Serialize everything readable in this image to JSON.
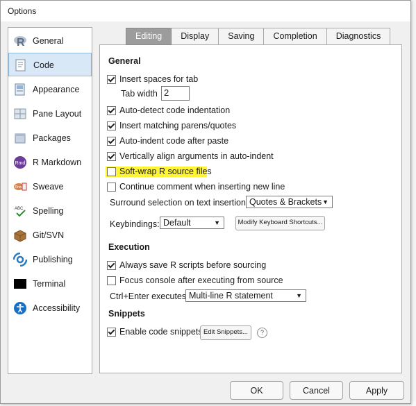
{
  "window": {
    "title": "Options"
  },
  "sidebar": {
    "items": [
      {
        "label": "General",
        "icon": "r-logo-icon"
      },
      {
        "label": "Code",
        "icon": "code-doc-icon",
        "active": true
      },
      {
        "label": "Appearance",
        "icon": "appearance-icon"
      },
      {
        "label": "Pane Layout",
        "icon": "pane-layout-icon"
      },
      {
        "label": "Packages",
        "icon": "packages-icon"
      },
      {
        "label": "R Markdown",
        "icon": "rmarkdown-icon"
      },
      {
        "label": "Sweave",
        "icon": "sweave-icon"
      },
      {
        "label": "Spelling",
        "icon": "spelling-icon"
      },
      {
        "label": "Git/SVN",
        "icon": "git-svn-icon"
      },
      {
        "label": "Publishing",
        "icon": "publishing-icon"
      },
      {
        "label": "Terminal",
        "icon": "terminal-icon"
      },
      {
        "label": "Accessibility",
        "icon": "accessibility-icon"
      }
    ]
  },
  "tabs": [
    "Editing",
    "Display",
    "Saving",
    "Completion",
    "Diagnostics"
  ],
  "editing": {
    "general_heading": "General",
    "insert_spaces": "Insert spaces for tab",
    "tab_width_label": "Tab width",
    "tab_width_value": "2",
    "auto_detect": "Auto-detect code indentation",
    "insert_matching": "Insert matching parens/quotes",
    "auto_indent": "Auto-indent code after paste",
    "vertically_align": "Vertically align arguments in auto-indent",
    "soft_wrap": "Soft-wrap R source files",
    "continue_comment": "Continue comment when inserting new line",
    "surround_label": "Surround selection on text insertion:",
    "surround_value": "Quotes & Brackets",
    "keybindings_label": "Keybindings:",
    "keybindings_value": "Default",
    "modify_shortcuts": "Modify Keyboard Shortcuts...",
    "execution_heading": "Execution",
    "always_save": "Always save R scripts before sourcing",
    "focus_console": "Focus console after executing from source",
    "ctrl_enter_label": "Ctrl+Enter executes:",
    "ctrl_enter_value": "Multi-line R statement",
    "snippets_heading": "Snippets",
    "enable_snippets": "Enable code snippets",
    "edit_snippets": "Edit Snippets...",
    "help_symbol": "?"
  },
  "buttons": {
    "ok": "OK",
    "cancel": "Cancel",
    "apply": "Apply"
  },
  "colors": {
    "highlight": "#fff200",
    "active_tab": "#9c9c9c",
    "selected_nav": "#d9e8f7"
  }
}
